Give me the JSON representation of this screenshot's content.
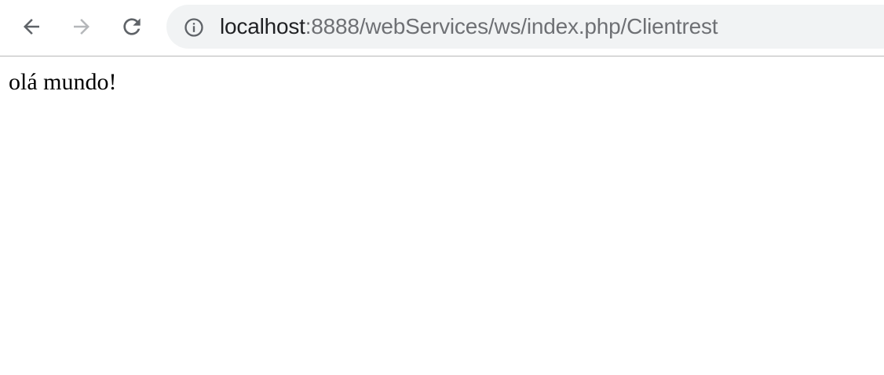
{
  "browser": {
    "address_bar": {
      "host": "localhost",
      "path": ":8888/webServices/ws/index.php/Clientrest"
    },
    "icons": {
      "back": "back-arrow-icon",
      "forward": "forward-arrow-icon",
      "reload": "reload-icon",
      "site_info": "info-icon"
    },
    "colors": {
      "toolbar_bg": "#ffffff",
      "omnibox_bg": "#f1f3f4",
      "icon_active": "#5f6368",
      "icon_disabled": "#b5b7ba"
    }
  },
  "page": {
    "body_text": "olá mundo!"
  }
}
